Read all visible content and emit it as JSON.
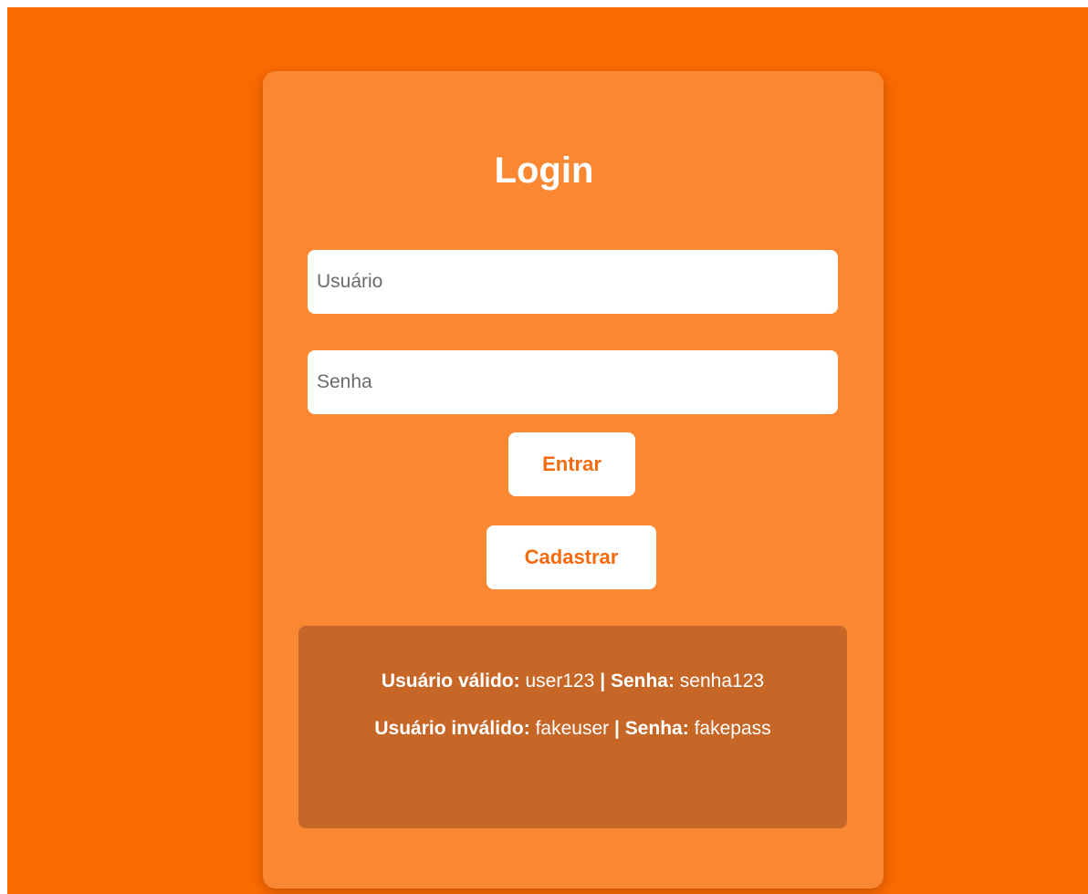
{
  "colors": {
    "background": "#fa6a00",
    "card": "#fa8832",
    "info_box": "#c66727",
    "button_text": "#f56a0e"
  },
  "login": {
    "title": "Login",
    "username_placeholder": "Usuário",
    "password_placeholder": "Senha",
    "enter_label": "Entrar",
    "register_label": "Cadastrar"
  },
  "info": {
    "valid_user_label": "Usuário válido:",
    "valid_user_value": "user123",
    "valid_separator": "|",
    "valid_pass_label": "Senha:",
    "valid_pass_value": "senha123",
    "invalid_user_label": "Usuário inválido:",
    "invalid_user_value": "fakeuser",
    "invalid_separator": "|",
    "invalid_pass_label": "Senha:",
    "invalid_pass_value": "fakepass"
  }
}
